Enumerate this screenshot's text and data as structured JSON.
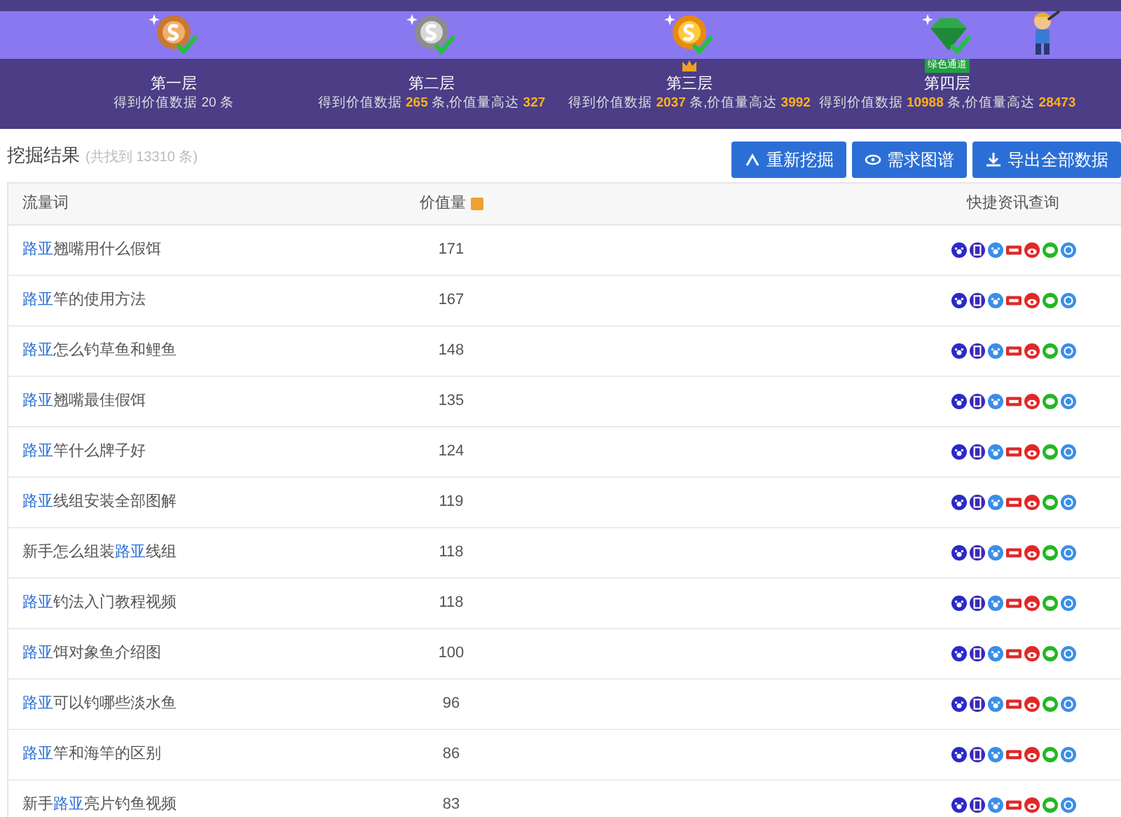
{
  "levels": [
    {
      "kind": "bronze",
      "title": "第一层",
      "crown": false,
      "description": [
        {
          "text": "得到价值数据 20 条",
          "highlight": false
        }
      ]
    },
    {
      "kind": "silver",
      "title": "第二层",
      "crown": false,
      "description": [
        {
          "text": "得到价值数据 ",
          "highlight": false
        },
        {
          "text": "265",
          "highlight": true
        },
        {
          "text": " 条,价值量高达 ",
          "highlight": false
        },
        {
          "text": "327",
          "highlight": true
        }
      ]
    },
    {
      "kind": "gold",
      "title": "第三层",
      "crown": true,
      "description": [
        {
          "text": "得到价值数据 ",
          "highlight": false
        },
        {
          "text": "2037",
          "highlight": true
        },
        {
          "text": " 条,价值量高达 ",
          "highlight": false
        },
        {
          "text": "3992",
          "highlight": true
        }
      ]
    },
    {
      "kind": "gem",
      "title": "第四层",
      "crown": false,
      "badge": "绿色通道",
      "description": [
        {
          "text": "得到价值数据 ",
          "highlight": false
        },
        {
          "text": "10988",
          "highlight": true
        },
        {
          "text": " 条,价值量高达 ",
          "highlight": false
        },
        {
          "text": "28473",
          "highlight": true
        }
      ]
    }
  ],
  "results": {
    "title": "挖掘结果",
    "count": "(共找到 13310 条)",
    "buttons": [
      {
        "kind": "dig",
        "label": "重新挖掘"
      },
      {
        "kind": "map",
        "label": "需求图谱"
      },
      {
        "kind": "export",
        "label": "导出全部数据"
      }
    ]
  },
  "table": {
    "columns": [
      {
        "label": "流量词",
        "help": false
      },
      {
        "label": "价值量",
        "help": true
      },
      {
        "label": "快捷资讯查询",
        "help": false
      }
    ],
    "rows": [
      {
        "keyword": [
          {
            "text": "路亚",
            "highlight": true
          },
          {
            "text": "翘嘴用什么假饵",
            "highlight": false
          }
        ],
        "value": "171"
      },
      {
        "keyword": [
          {
            "text": "路亚",
            "highlight": true
          },
          {
            "text": "竿的使用方法",
            "highlight": false
          }
        ],
        "value": "167"
      },
      {
        "keyword": [
          {
            "text": "路亚",
            "highlight": true
          },
          {
            "text": "怎么钓草鱼和鲤鱼",
            "highlight": false
          }
        ],
        "value": "148"
      },
      {
        "keyword": [
          {
            "text": "路亚",
            "highlight": true
          },
          {
            "text": "翘嘴最佳假饵",
            "highlight": false
          }
        ],
        "value": "135"
      },
      {
        "keyword": [
          {
            "text": "路亚",
            "highlight": true
          },
          {
            "text": "竿什么牌子好",
            "highlight": false
          }
        ],
        "value": "124"
      },
      {
        "keyword": [
          {
            "text": "路亚",
            "highlight": true
          },
          {
            "text": "线组安装全部图解",
            "highlight": false
          }
        ],
        "value": "119"
      },
      {
        "keyword": [
          {
            "text": "新手怎么组装",
            "highlight": false
          },
          {
            "text": "路亚",
            "highlight": true
          },
          {
            "text": "线组",
            "highlight": false
          }
        ],
        "value": "118"
      },
      {
        "keyword": [
          {
            "text": "路亚",
            "highlight": true
          },
          {
            "text": "钓法入门教程视频",
            "highlight": false
          }
        ],
        "value": "118"
      },
      {
        "keyword": [
          {
            "text": "路亚",
            "highlight": true
          },
          {
            "text": "饵对象鱼介绍图",
            "highlight": false
          }
        ],
        "value": "100"
      },
      {
        "keyword": [
          {
            "text": "路亚",
            "highlight": true
          },
          {
            "text": "可以钓哪些淡水鱼",
            "highlight": false
          }
        ],
        "value": "96"
      },
      {
        "keyword": [
          {
            "text": "路亚",
            "highlight": true
          },
          {
            "text": "竿和海竿的区别",
            "highlight": false
          }
        ],
        "value": "86"
      },
      {
        "keyword": [
          {
            "text": "新手",
            "highlight": false
          },
          {
            "text": "路亚",
            "highlight": true
          },
          {
            "text": "亮片钓鱼视频",
            "highlight": false
          }
        ],
        "value": "83"
      }
    ]
  }
}
